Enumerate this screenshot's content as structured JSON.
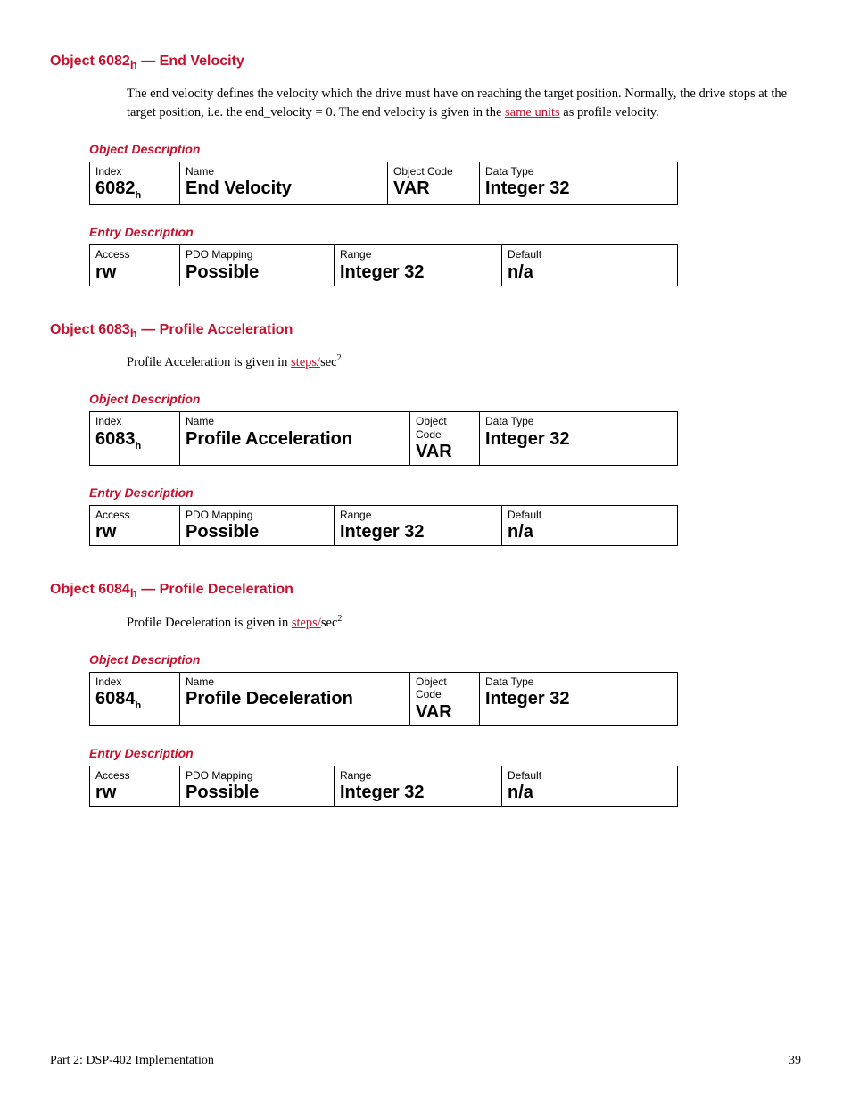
{
  "sections": [
    {
      "title_pre": "Object 6082",
      "title_post": " — End Velocity",
      "body_pre": "The end velocity defines the velocity which the drive must have on reaching the target position. Normally, the drive stops at the target position, i.e. the end_velocity = 0. The end velocity is given in the ",
      "body_link": "same units",
      "body_post": " as profile velocity.",
      "sup": "",
      "objdesc": {
        "index": "6082",
        "name": "End Velocity",
        "code": "VAR",
        "dtype": "Integer 32"
      },
      "entrydesc": {
        "access": "rw",
        "pdo": "Possible",
        "range": "Integer 32",
        "default": "n/a"
      }
    },
    {
      "title_pre": "Object 6083",
      "title_post": " — Profile Acceleration",
      "body_pre": "Profile Acceleration is given in ",
      "body_link": "steps/",
      "body_post": "sec",
      "sup": "2",
      "objdesc": {
        "index": "6083",
        "name": "Profile Acceleration",
        "code": "VAR",
        "dtype": "Integer 32"
      },
      "entrydesc": {
        "access": "rw",
        "pdo": "Possible",
        "range": "Integer 32",
        "default": "n/a"
      }
    },
    {
      "title_pre": "Object 6084",
      "title_post": " — Profile Deceleration",
      "body_pre": "Profile Deceleration is given in ",
      "body_link": "steps/",
      "body_post": "sec",
      "sup": "2",
      "objdesc": {
        "index": "6084",
        "name": "Profile Deceleration",
        "code": "VAR",
        "dtype": "Integer 32"
      },
      "entrydesc": {
        "access": "rw",
        "pdo": "Possible",
        "range": "Integer 32",
        "default": "n/a"
      }
    }
  ],
  "labels": {
    "objdesc": "Object Description",
    "entrydesc": "Entry Description",
    "index": "Index",
    "name": "Name",
    "code": "Object Code",
    "dtype": "Data Type",
    "access": "Access",
    "pdo": "PDO Mapping",
    "range": "Range",
    "default": "Default",
    "h": "h"
  },
  "footer": {
    "left": "Part 2: DSP-402 Implementation",
    "right": "39"
  }
}
